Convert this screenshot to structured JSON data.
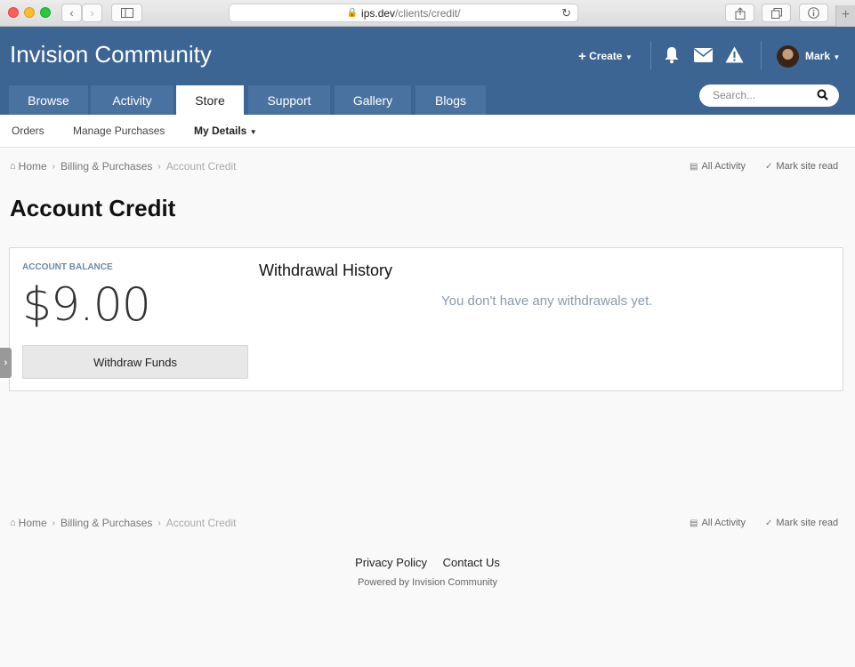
{
  "browser": {
    "url_host": "ips.dev",
    "url_path": "/clients/credit/"
  },
  "header": {
    "site_title": "Invision Community",
    "create_label": "Create",
    "user_name": "Mark"
  },
  "tabs": [
    {
      "label": "Browse"
    },
    {
      "label": "Activity"
    },
    {
      "label": "Store"
    },
    {
      "label": "Support"
    },
    {
      "label": "Gallery"
    },
    {
      "label": "Blogs"
    }
  ],
  "search": {
    "placeholder": "Search..."
  },
  "subnav": {
    "orders": "Orders",
    "manage": "Manage Purchases",
    "details": "My Details"
  },
  "breadcrumb": {
    "home": "Home",
    "billing": "Billing & Purchases",
    "current": "Account Credit",
    "all_activity": "All Activity",
    "mark_read": "Mark site read"
  },
  "page": {
    "title": "Account Credit",
    "balance_label": "ACCOUNT BALANCE",
    "balance_value": "$9.00",
    "withdraw_button": "Withdraw Funds",
    "history_title": "Withdrawal History",
    "history_empty": "You don't have any withdrawals yet."
  },
  "footer": {
    "privacy": "Privacy Policy",
    "contact": "Contact Us",
    "powered": "Powered by Invision Community"
  },
  "colors": {
    "header_bg": "#3d6594",
    "tab_bg": "#4a72a0"
  }
}
